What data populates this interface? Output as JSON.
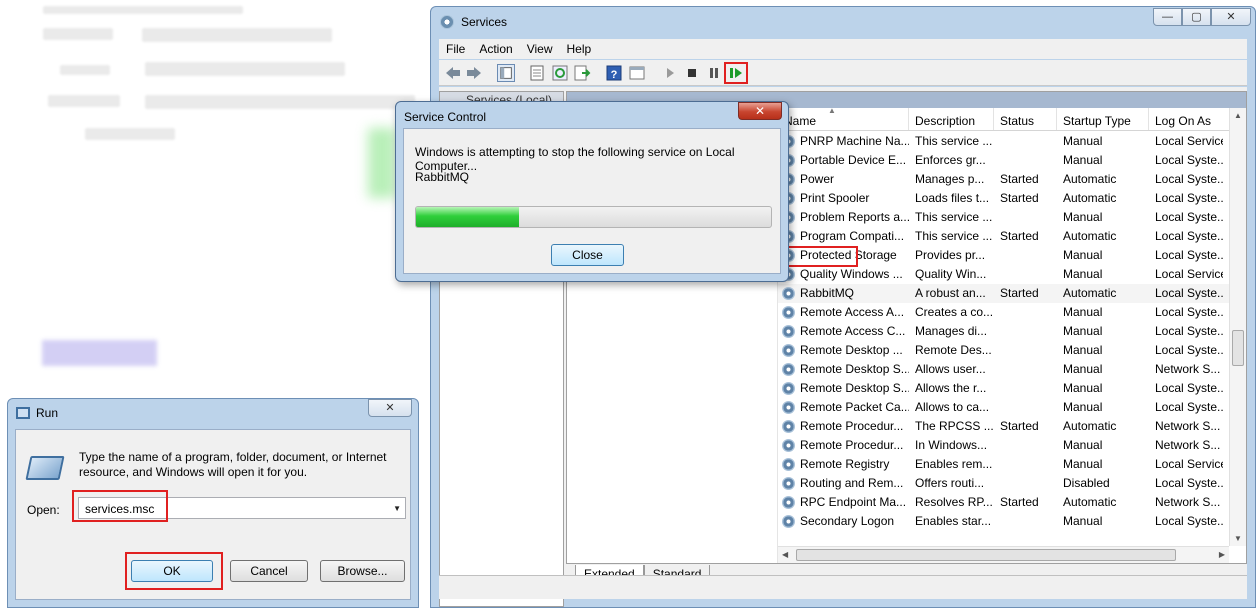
{
  "services_window": {
    "title": "Services",
    "window_buttons": [
      "—",
      "▢",
      "✕"
    ],
    "menu": [
      "File",
      "Action",
      "View",
      "Help"
    ],
    "tree_root": "Services (Local)",
    "columns": [
      "Name",
      "Description",
      "Status",
      "Startup Type",
      "Log On As"
    ],
    "rows": [
      {
        "name": "PNRP Machine Na...",
        "desc": "This service ...",
        "status": "",
        "startup": "Manual",
        "logon": "Local Service"
      },
      {
        "name": "Portable Device E...",
        "desc": "Enforces gr...",
        "status": "",
        "startup": "Manual",
        "logon": "Local Syste..."
      },
      {
        "name": "Power",
        "desc": "Manages p...",
        "status": "Started",
        "startup": "Automatic",
        "logon": "Local Syste..."
      },
      {
        "name": "Print Spooler",
        "desc": "Loads files t...",
        "status": "Started",
        "startup": "Automatic",
        "logon": "Local Syste..."
      },
      {
        "name": "Problem Reports a...",
        "desc": "This service ...",
        "status": "",
        "startup": "Manual",
        "logon": "Local Syste..."
      },
      {
        "name": "Program Compati...",
        "desc": "This service ...",
        "status": "Started",
        "startup": "Automatic",
        "logon": "Local Syste..."
      },
      {
        "name": "Protected Storage",
        "desc": "Provides pr...",
        "status": "",
        "startup": "Manual",
        "logon": "Local Syste..."
      },
      {
        "name": "Quality Windows ...",
        "desc": "Quality Win...",
        "status": "",
        "startup": "Manual",
        "logon": "Local Service"
      },
      {
        "name": "RabbitMQ",
        "desc": "A robust an...",
        "status": "Started",
        "startup": "Automatic",
        "logon": "Local Syste..."
      },
      {
        "name": "Remote Access A...",
        "desc": "Creates a co...",
        "status": "",
        "startup": "Manual",
        "logon": "Local Syste..."
      },
      {
        "name": "Remote Access C...",
        "desc": "Manages di...",
        "status": "",
        "startup": "Manual",
        "logon": "Local Syste..."
      },
      {
        "name": "Remote Desktop ...",
        "desc": "Remote Des...",
        "status": "",
        "startup": "Manual",
        "logon": "Local Syste..."
      },
      {
        "name": "Remote Desktop S...",
        "desc": "Allows user...",
        "status": "",
        "startup": "Manual",
        "logon": "Network S..."
      },
      {
        "name": "Remote Desktop S...",
        "desc": "Allows the r...",
        "status": "",
        "startup": "Manual",
        "logon": "Local Syste..."
      },
      {
        "name": "Remote Packet Ca...",
        "desc": "Allows to ca...",
        "status": "",
        "startup": "Manual",
        "logon": "Local Syste..."
      },
      {
        "name": "Remote Procedur...",
        "desc": "The RPCSS ...",
        "status": "Started",
        "startup": "Automatic",
        "logon": "Network S..."
      },
      {
        "name": "Remote Procedur...",
        "desc": "In Windows...",
        "status": "",
        "startup": "Manual",
        "logon": "Network S..."
      },
      {
        "name": "Remote Registry",
        "desc": "Enables rem...",
        "status": "",
        "startup": "Manual",
        "logon": "Local Service"
      },
      {
        "name": "Routing and Rem...",
        "desc": "Offers routi...",
        "status": "",
        "startup": "Disabled",
        "logon": "Local Syste..."
      },
      {
        "name": "RPC Endpoint Ma...",
        "desc": "Resolves RP...",
        "status": "Started",
        "startup": "Automatic",
        "logon": "Network S..."
      },
      {
        "name": "Secondary Logon",
        "desc": "Enables star...",
        "status": "",
        "startup": "Manual",
        "logon": "Local Syste..."
      }
    ],
    "selected_row": "RabbitMQ",
    "tabs": [
      "Extended",
      "Standard"
    ],
    "toolbar_icons": [
      "back-icon",
      "forward-icon",
      "show-tree-icon",
      "properties-icon",
      "refresh-icon",
      "export-icon",
      "help-icon",
      "view-icon",
      "start-icon",
      "stop-icon",
      "pause-icon",
      "restart-icon"
    ]
  },
  "service_control": {
    "title": "Service Control",
    "close_x": "✕",
    "message": "Windows is attempting to stop the following service on Local Computer...",
    "service": "RabbitMQ",
    "progress_fraction": 0.29,
    "close_button": "Close"
  },
  "run_dialog": {
    "title": "Run",
    "close_x": "✕",
    "description": "Type the name of a program, folder, document, or Internet resource, and Windows will open it for you.",
    "open_label": "Open:",
    "open_value": "services.msc",
    "ok": "OK",
    "cancel": "Cancel",
    "browse": "Browse..."
  },
  "colors": {
    "highlight_box": "#e02020",
    "progress_green": "#2fcf3b",
    "window_frame": "#bcd3ea"
  }
}
